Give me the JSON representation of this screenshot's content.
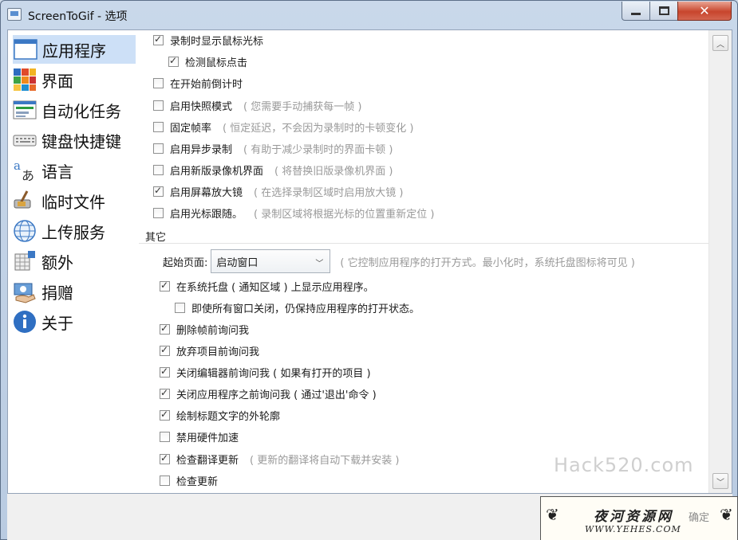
{
  "window": {
    "title": "ScreenToGif - 选项"
  },
  "sidebar": {
    "items": [
      {
        "label": "应用程序",
        "icon": "app-window-icon",
        "selected": true
      },
      {
        "label": "界面",
        "icon": "palette-tiles-icon"
      },
      {
        "label": "自动化任务",
        "icon": "task-list-icon"
      },
      {
        "label": "键盘快捷键",
        "icon": "keyboard-icon"
      },
      {
        "label": "语言",
        "icon": "language-icon"
      },
      {
        "label": "临时文件",
        "icon": "disk-broom-icon"
      },
      {
        "label": "上传服务",
        "icon": "globe-icon"
      },
      {
        "label": "额外",
        "icon": "puzzle-icon"
      },
      {
        "label": "捐赠",
        "icon": "donate-money-icon"
      },
      {
        "label": "关于",
        "icon": "info-icon"
      }
    ]
  },
  "options": [
    {
      "label": "录制时显示鼠标光标",
      "checked": true,
      "note": ""
    },
    {
      "label": "检测鼠标点击",
      "checked": true,
      "note": ""
    },
    {
      "label": "在开始前倒计时",
      "checked": false,
      "note": ""
    },
    {
      "label": "启用快照模式",
      "checked": false,
      "note": "( 您需要手动捕获每一帧 )"
    },
    {
      "label": "固定帧率",
      "checked": false,
      "note": "( 恒定延迟，不会因为录制时的卡顿变化 )"
    },
    {
      "label": "启用异步录制",
      "checked": false,
      "note": "( 有助于减少录制时的界面卡顿 )"
    },
    {
      "label": "启用新版录像机界面",
      "checked": false,
      "note": "( 将替换旧版录像机界面 )"
    },
    {
      "label": "启用屏幕放大镜",
      "checked": true,
      "note": "( 在选择录制区域时启用放大镜 )"
    },
    {
      "label": "启用光标跟随。",
      "checked": false,
      "note": "( 录制区域将根据光标的位置重新定位 )"
    }
  ],
  "other": {
    "header": "其它",
    "start_page_label": "起始页面:",
    "start_page_value": "启动窗口",
    "start_page_note": "( 它控制应用程序的打开方式。最小化时，系统托盘图标将可见 )",
    "items": [
      {
        "label": "在系统托盘 ( 通知区域 ) 上显示应用程序。",
        "checked": true
      },
      {
        "label": "即使所有窗口关闭，仍保持应用程序的打开状态。",
        "checked": false
      },
      {
        "label": "删除帧前询问我",
        "checked": true
      },
      {
        "label": "放弃项目前询问我",
        "checked": true
      },
      {
        "label": "关闭编辑器前询问我 ( 如果有打开的项目 )",
        "checked": true
      },
      {
        "label": "关闭应用程序之前询问我 ( 通过'退出'命令 )",
        "checked": true
      },
      {
        "label": "绘制标题文字的外轮廓",
        "checked": true
      },
      {
        "label": "禁用硬件加速",
        "checked": false
      },
      {
        "label": "检查翻译更新",
        "checked": true,
        "note": "( 更新的翻译将自动下载并安装 )"
      },
      {
        "label": "检查更新",
        "checked": false
      }
    ]
  },
  "footer": {
    "ok_label": "确定"
  },
  "watermark": {
    "text": "Hack520.com"
  },
  "logo": {
    "title": "夜河资源网",
    "url": "WWW.YEHES.COM"
  }
}
